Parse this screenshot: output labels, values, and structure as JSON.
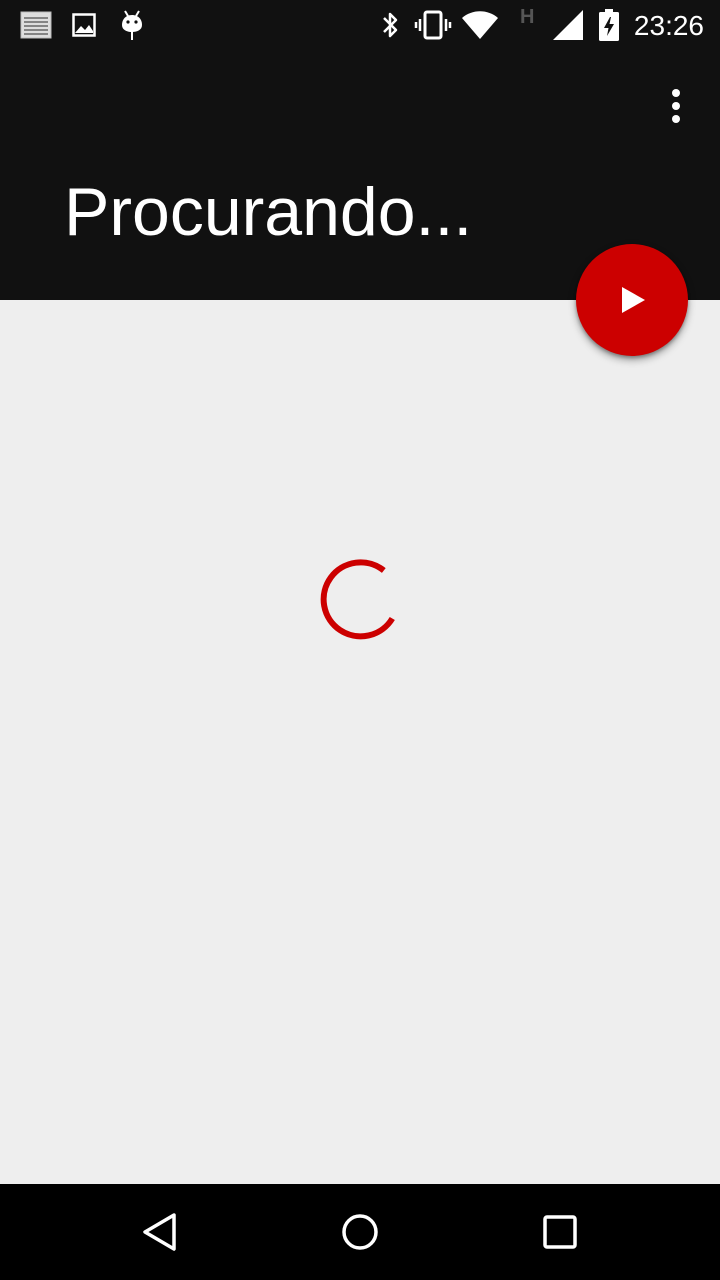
{
  "status_bar": {
    "time": "23:26",
    "network_type": "H",
    "left_icons": [
      "notes-icon",
      "image-icon",
      "android-icon"
    ],
    "right_icons": [
      "bluetooth-icon",
      "vibrate-icon",
      "wifi-icon",
      "signal-icon",
      "battery-charging-icon"
    ]
  },
  "app_bar": {
    "title": "Procurando...",
    "menu_icon": "overflow-menu-icon"
  },
  "fab": {
    "icon": "play-icon",
    "color": "#cc0000"
  },
  "content": {
    "spinner_color": "#cc0000",
    "background": "#eeeeee"
  },
  "nav_bar": {
    "buttons": [
      "back-icon",
      "home-icon",
      "recents-icon"
    ]
  }
}
